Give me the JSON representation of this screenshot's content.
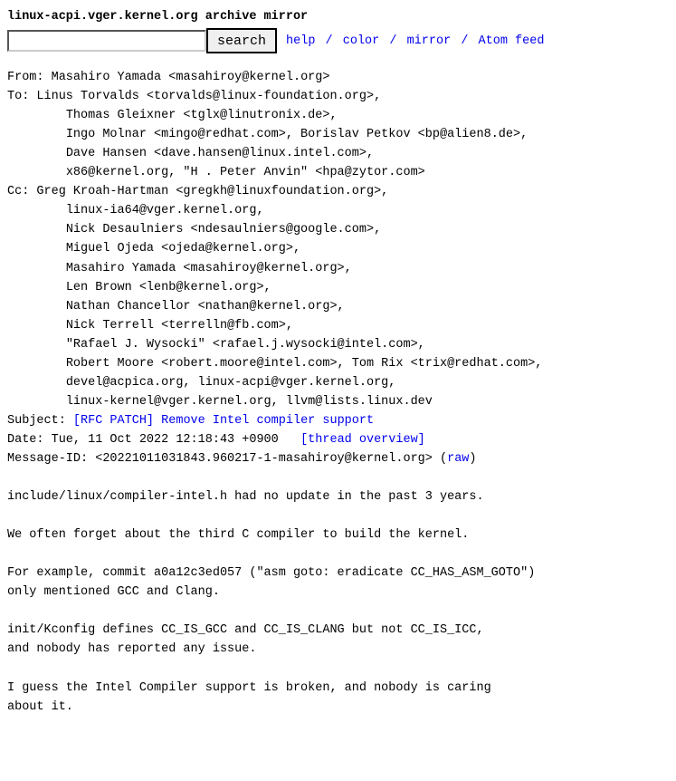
{
  "header": {
    "title": "linux-acpi.vger.kernel.org archive mirror"
  },
  "search": {
    "button": "search"
  },
  "nav": {
    "help": "help",
    "color": "color",
    "mirror": "mirror",
    "atom": "Atom feed",
    "sep": "/"
  },
  "labels": {
    "from": "From: ",
    "to": "To: ",
    "cc": "Cc: ",
    "subject": "Subject: ",
    "date": "Date: ",
    "msgid": "Message-ID: "
  },
  "from": {
    "name": "Masahiro Yamada",
    "email": "<masahiroy@kernel.org>"
  },
  "to": {
    "l1": "Linus Torvalds <torvalds@linux-foundation.org>,",
    "l2": "Thomas Gleixner <tglx@linutronix.de>,",
    "l3": "Ingo Molnar <mingo@redhat.com>, Borislav Petkov <bp@alien8.de>,",
    "l4": "Dave Hansen <dave.hansen@linux.intel.com>,",
    "l5": "x86@kernel.org, \"H . Peter Anvin\" <hpa@zytor.com>"
  },
  "cc": {
    "l1": "Greg Kroah-Hartman <gregkh@linuxfoundation.org>,",
    "l2": "linux-ia64@vger.kernel.org,",
    "l3": "Nick Desaulniers <ndesaulniers@google.com>,",
    "l4": "Miguel Ojeda <ojeda@kernel.org>,",
    "l5": "Masahiro Yamada <masahiroy@kernel.org>,",
    "l6": "Len Brown <lenb@kernel.org>,",
    "l7": "Nathan Chancellor <nathan@kernel.org>,",
    "l8": "Nick Terrell <terrelln@fb.com>,",
    "l9": "\"Rafael J. Wysocki\" <rafael.j.wysocki@intel.com>,",
    "l10": "Robert Moore <robert.moore@intel.com>, Tom Rix <trix@redhat.com>,",
    "l11": "devel@acpica.org, linux-acpi@vger.kernel.org,",
    "l12": "linux-kernel@vger.kernel.org, llvm@lists.linux.dev"
  },
  "subject": "[RFC PATCH] Remove Intel compiler support",
  "date": {
    "value": "Tue, 11 Oct 2022 12:18:43 +0900",
    "overview": "[thread overview]"
  },
  "msgid": {
    "value": "<20221011031843.960217-1-masahiroy@kernel.org>",
    "raw": "raw"
  },
  "body": {
    "p1": "include/linux/compiler-intel.h had no update in the past 3 years.",
    "p2": "We often forget about the third C compiler to build the kernel.",
    "p3a": "For example, commit a0a12c3ed057 (\"asm goto: eradicate CC_HAS_ASM_GOTO\")",
    "p3b": "only mentioned GCC and Clang.",
    "p4a": "init/Kconfig defines CC_IS_GCC and CC_IS_CLANG but not CC_IS_ICC,",
    "p4b": "and nobody has reported any issue.",
    "p5a": "I guess the Intel Compiler support is broken, and nobody is caring",
    "p5b": "about it."
  },
  "pad": "\t"
}
